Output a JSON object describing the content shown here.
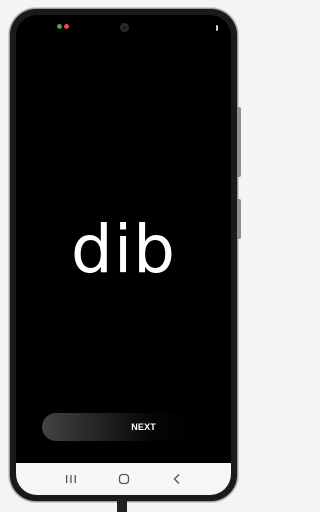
{
  "app": {
    "logo_text": "dib",
    "next_label": "NEXT"
  },
  "status_bar": {
    "notification_icons": [
      {
        "name": "notification-icon-1",
        "color": "#3aa84a"
      },
      {
        "name": "notification-icon-2",
        "color": "#e84b3a"
      }
    ]
  },
  "nav_bar": {
    "buttons": [
      "recent-apps-icon",
      "home-icon",
      "back-icon"
    ]
  },
  "colors": {
    "screen_background": "#000000",
    "text": "#ffffff",
    "nav_background": "#f6f6f6"
  }
}
